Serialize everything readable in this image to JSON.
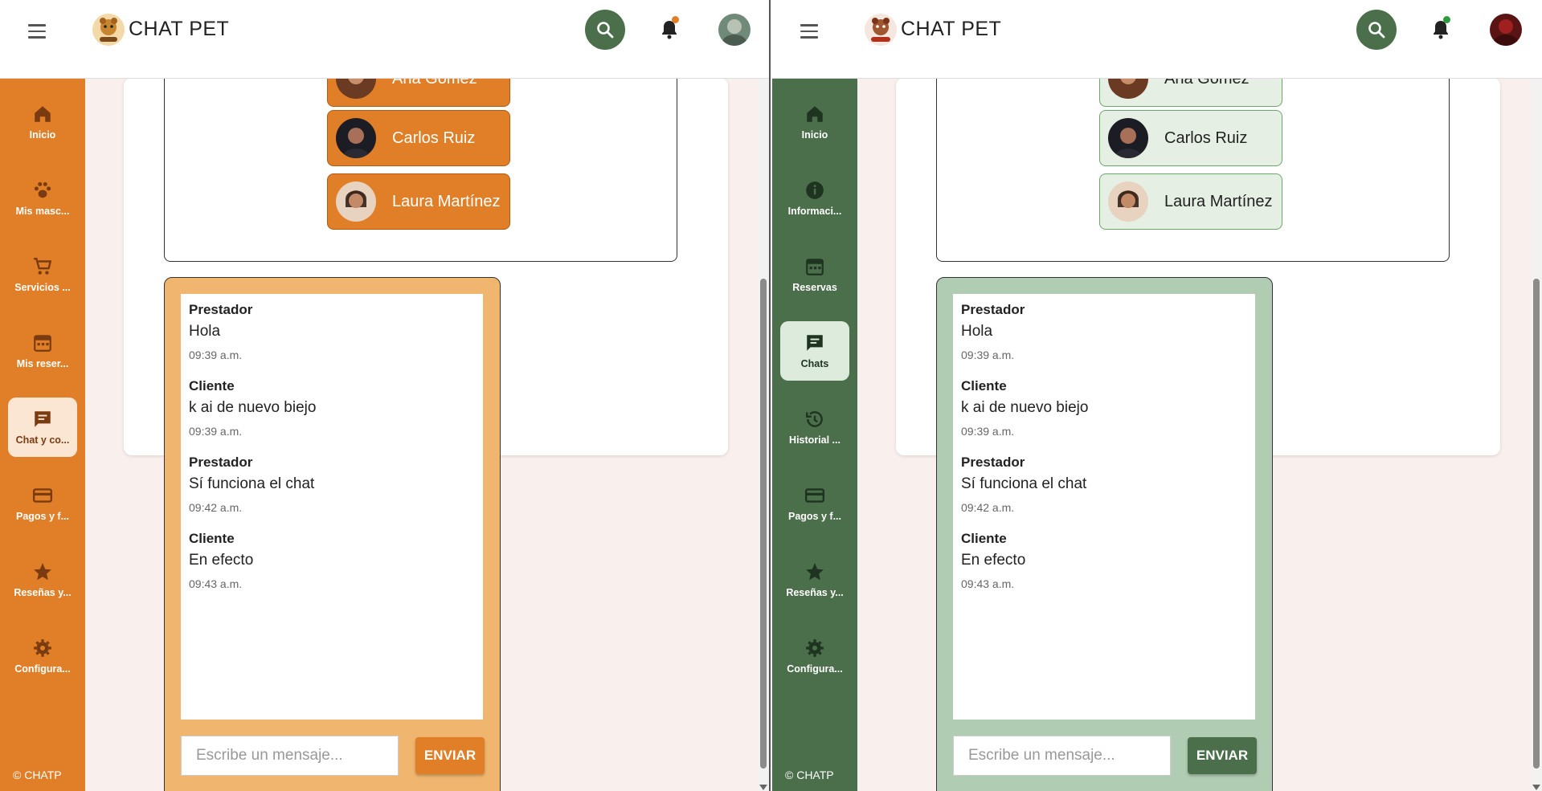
{
  "left": {
    "brand": "CHAT PET",
    "accent": "#e07f27",
    "sidebar": [
      {
        "icon": "home-icon",
        "label": "Inicio"
      },
      {
        "icon": "paw-icon",
        "label": "Mis masc..."
      },
      {
        "icon": "cart-icon",
        "label": "Servicios ..."
      },
      {
        "icon": "calendar-icon",
        "label": "Mis reser..."
      },
      {
        "icon": "chat-icon",
        "label": "Chat y co...",
        "active": true
      },
      {
        "icon": "credit-card-icon",
        "label": "Pagos y f..."
      },
      {
        "icon": "star-icon",
        "label": "Reseñas y..."
      },
      {
        "icon": "gear-icon",
        "label": "Configura..."
      }
    ],
    "copyright": "© CHATP",
    "contacts": [
      {
        "name": "Ana Gómez"
      },
      {
        "name": "Carlos Ruiz"
      },
      {
        "name": "Laura Martínez"
      }
    ],
    "messages": [
      {
        "sender": "Prestador",
        "text": "Hola",
        "time": "09:39 a.m."
      },
      {
        "sender": "Cliente",
        "text": "k ai de nuevo biejo",
        "time": "09:39 a.m."
      },
      {
        "sender": "Prestador",
        "text": "Sí funciona el chat",
        "time": "09:42 a.m."
      },
      {
        "sender": "Cliente",
        "text": "En efecto",
        "time": "09:43 a.m."
      }
    ],
    "input_placeholder": "Escribe un mensaje...",
    "send_label": "ENVIAR"
  },
  "right": {
    "brand": "CHAT PET",
    "accent": "#4b6e4b",
    "sidebar": [
      {
        "icon": "home-icon",
        "label": "Inicio"
      },
      {
        "icon": "info-icon",
        "label": "Informaci..."
      },
      {
        "icon": "calendar-icon",
        "label": "Reservas"
      },
      {
        "icon": "chat-icon",
        "label": "Chats",
        "active": true
      },
      {
        "icon": "history-icon",
        "label": "Historial ..."
      },
      {
        "icon": "credit-card-icon",
        "label": "Pagos y f..."
      },
      {
        "icon": "star-icon",
        "label": "Reseñas y..."
      },
      {
        "icon": "gear-icon",
        "label": "Configura..."
      }
    ],
    "copyright": "© CHATP",
    "contacts": [
      {
        "name": "Ana Gómez"
      },
      {
        "name": "Carlos Ruiz"
      },
      {
        "name": "Laura Martínez"
      }
    ],
    "messages": [
      {
        "sender": "Prestador",
        "text": "Hola",
        "time": "09:39 a.m."
      },
      {
        "sender": "Cliente",
        "text": "k ai de nuevo biejo",
        "time": "09:39 a.m."
      },
      {
        "sender": "Prestador",
        "text": "Sí funciona el chat",
        "time": "09:42 a.m."
      },
      {
        "sender": "Cliente",
        "text": "En efecto",
        "time": "09:43 a.m."
      }
    ],
    "input_placeholder": "Escribe un mensaje...",
    "send_label": "ENVIAR"
  }
}
